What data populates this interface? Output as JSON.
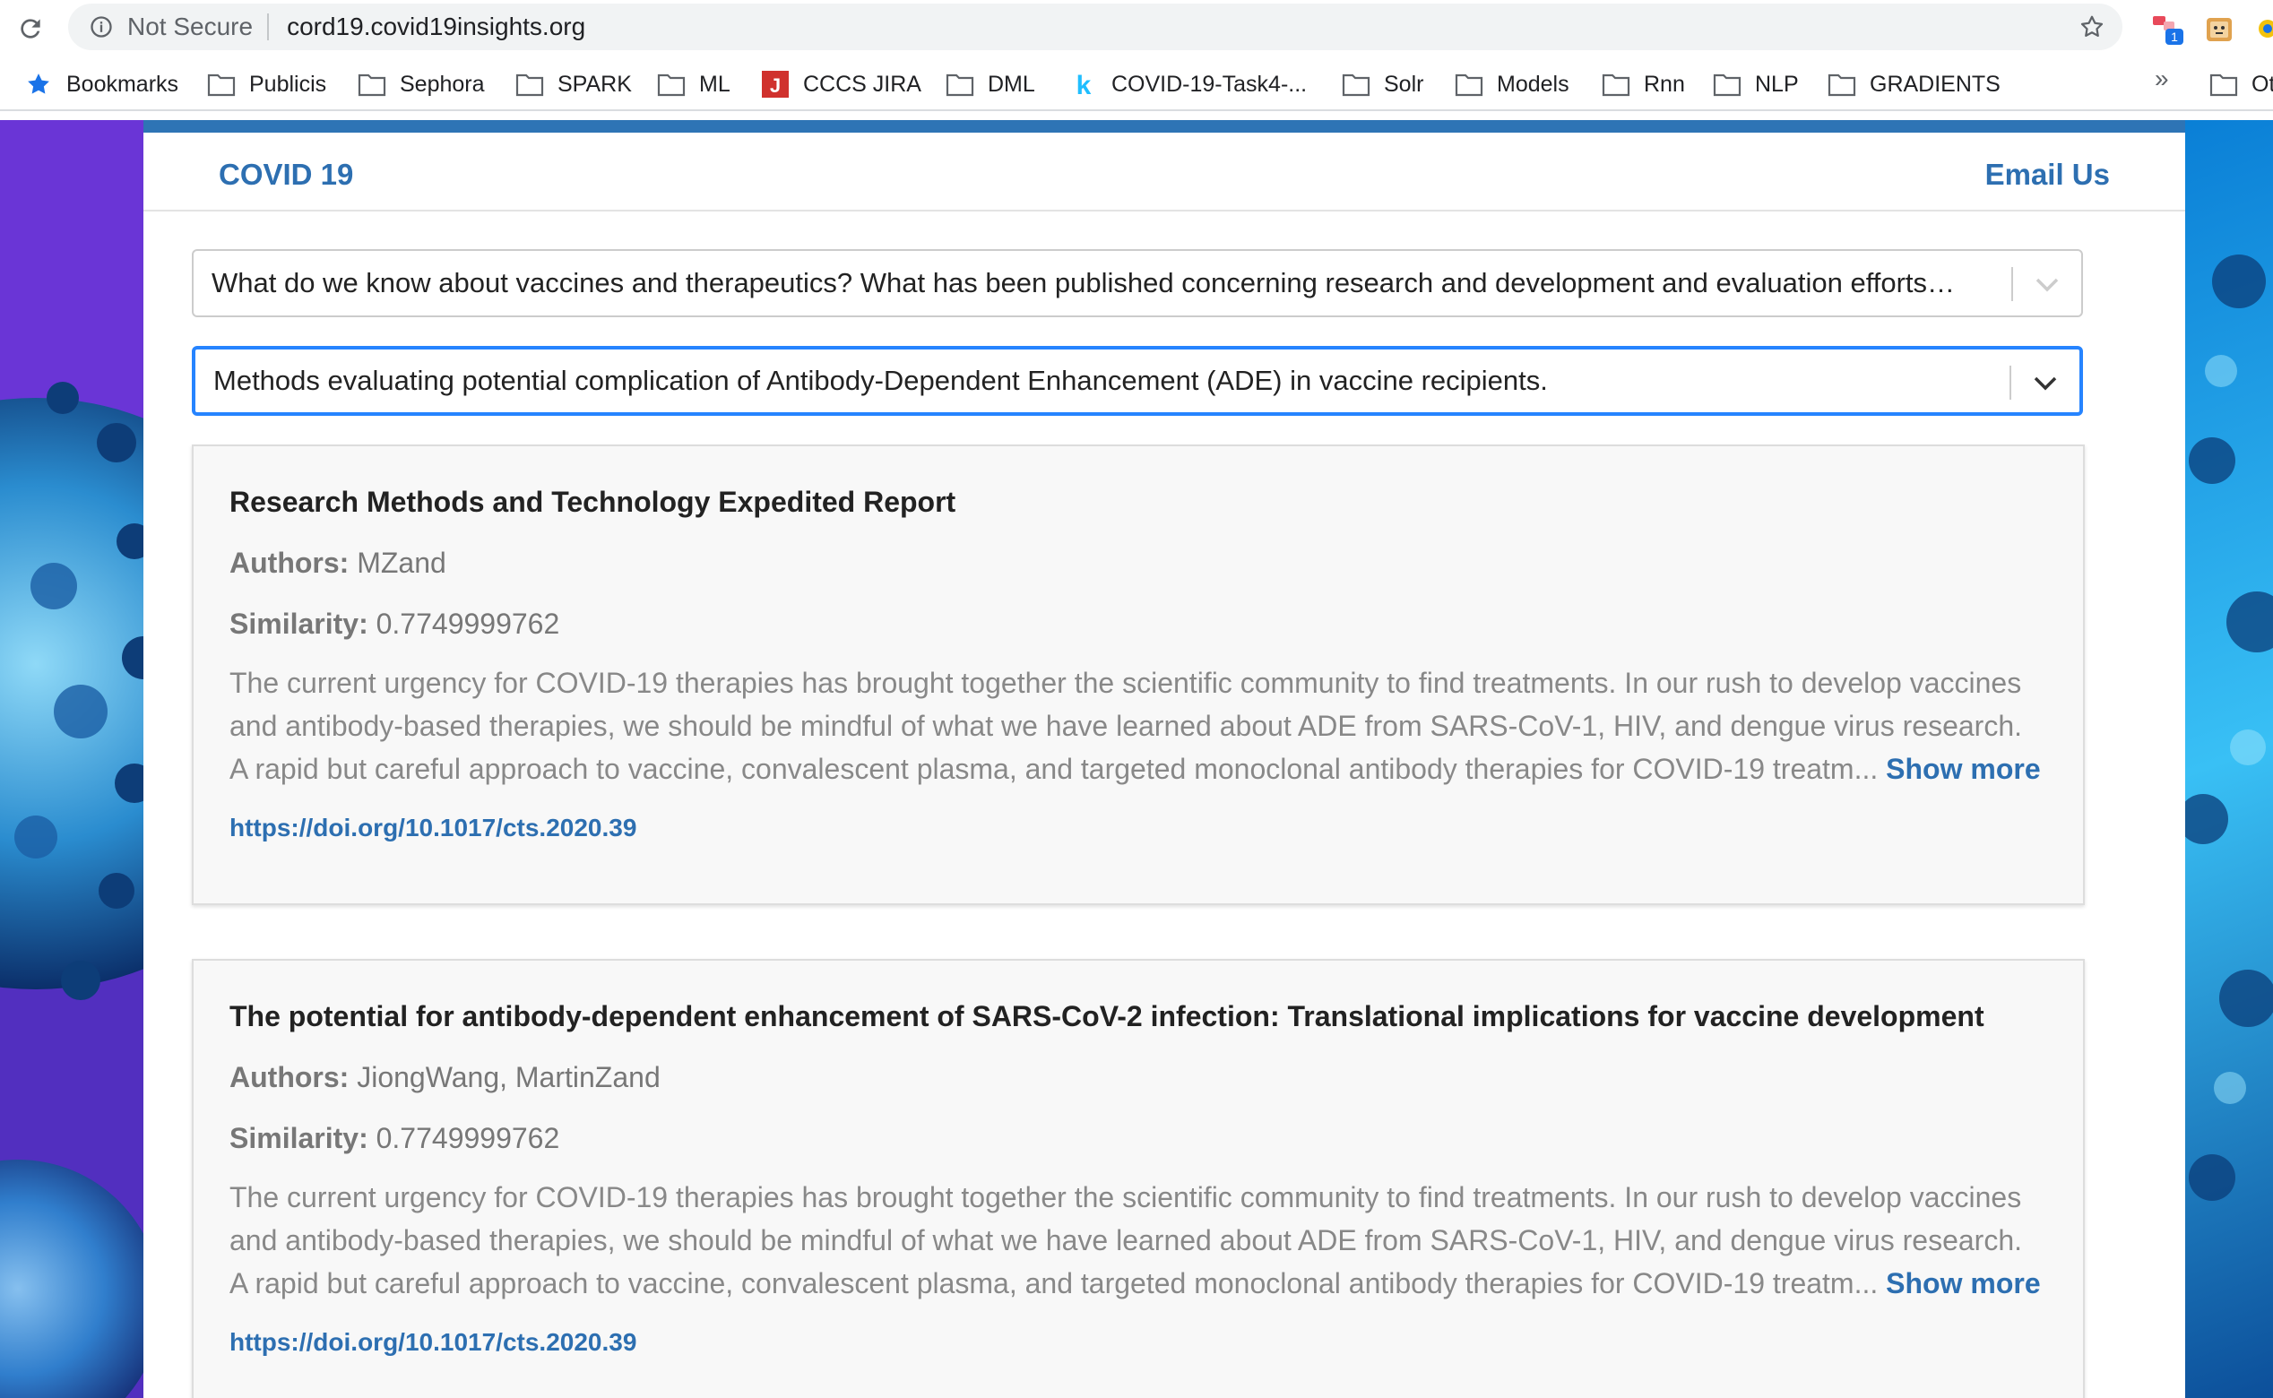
{
  "browser": {
    "security_label": "Not Secure",
    "url": "cord19.covid19insights.org",
    "extension_badge": "1",
    "bookmarks": [
      {
        "label": "Bookmarks",
        "icon": "star-icon"
      },
      {
        "label": "Publicis",
        "icon": "folder-icon"
      },
      {
        "label": "Sephora",
        "icon": "folder-icon"
      },
      {
        "label": "SPARK",
        "icon": "folder-icon"
      },
      {
        "label": "ML",
        "icon": "folder-icon"
      },
      {
        "label": "CCCS JIRA",
        "icon": "jira-icon"
      },
      {
        "label": "DML",
        "icon": "folder-icon"
      },
      {
        "label": "COVID-19-Task4-...",
        "icon": "kaggle-icon"
      },
      {
        "label": "Solr",
        "icon": "folder-icon"
      },
      {
        "label": "Models",
        "icon": "folder-icon"
      },
      {
        "label": "Rnn",
        "icon": "folder-icon"
      },
      {
        "label": "NLP",
        "icon": "folder-icon"
      },
      {
        "label": "GRADIENTS",
        "icon": "folder-icon"
      },
      {
        "label": "Ot",
        "icon": "folder-icon"
      }
    ],
    "bookmarks_overflow": "»"
  },
  "header": {
    "brand": "COVID 19",
    "email_link": "Email Us"
  },
  "filters": {
    "question": "What do we know about vaccines and therapeutics? What has been published concerning research and development and evaluation efforts…",
    "subtopic": "Methods evaluating potential complication of Antibody-Dependent Enhancement (ADE) in vaccine recipients."
  },
  "labels": {
    "authors": "Authors:",
    "similarity": "Similarity:",
    "show_more": "Show more"
  },
  "results": [
    {
      "title": "Research Methods and Technology Expedited Report",
      "authors": "MZand",
      "similarity": "0.7749999762",
      "abstract_lines": [
        "The current urgency for COVID-19 therapies has brought together the scientific community to find treatments. In our rush to develop vaccines",
        "and antibody-based therapies, we should be mindful of what we have learned about ADE from SARS-CoV-1, HIV, and dengue virus research.",
        "A rapid but careful approach to vaccine, convalescent plasma, and targeted monoclonal antibody therapies for COVID-19 treatm..."
      ],
      "doi": "https://doi.org/10.1017/cts.2020.39"
    },
    {
      "title": "The potential for antibody-dependent enhancement of SARS-CoV-2 infection: Translational implications for vaccine development",
      "authors": "JiongWang, MartinZand",
      "similarity": "0.7749999762",
      "abstract_lines": [
        "The current urgency for COVID-19 therapies has brought together the scientific community to find treatments. In our rush to develop vaccines",
        "and antibody-based therapies, we should be mindful of what we have learned about ADE from SARS-CoV-1, HIV, and dengue virus research.",
        "A rapid but careful approach to vaccine, convalescent plasma, and targeted monoclonal antibody therapies for COVID-19 treatm..."
      ],
      "doi": "https://doi.org/10.1017/cts.2020.39"
    }
  ],
  "colors": {
    "brand": "#2d6fb1",
    "focus": "#2684ff",
    "topbar": "#2e74b5"
  }
}
